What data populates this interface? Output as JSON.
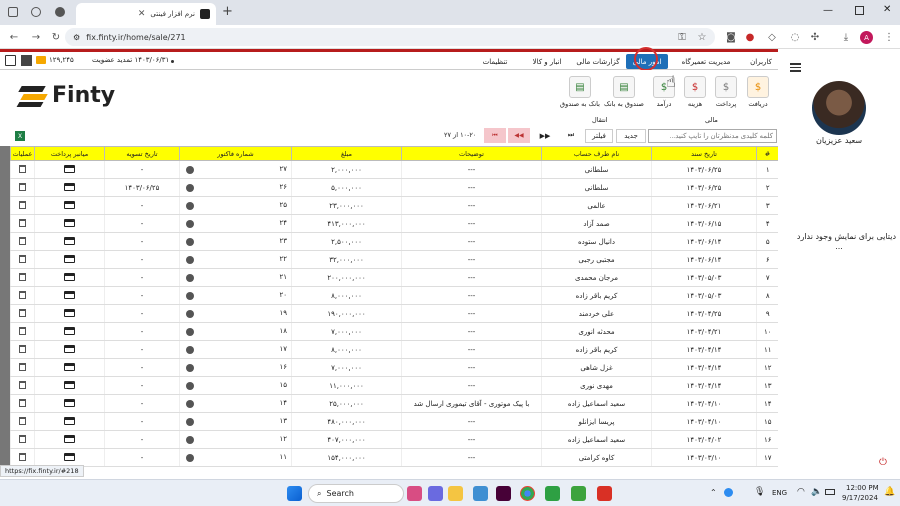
{
  "browser": {
    "tab_title": "نرم افزار فینتی",
    "url": "fix.finty.ir/home/sale/271",
    "profile_initial": "A",
    "status_url": "https://fix.finty.ir/#218"
  },
  "app": {
    "menu_tabs": [
      "کاربران",
      "مدیریت تعمیرگاه",
      "امور مالی",
      "گزارشات مالی",
      "انبار و کالا",
      "تنظیمات"
    ],
    "active_tab": "امور مالی",
    "account_text": "۱۴۰۳/۰۶/۳۱ تمدید عضویت",
    "balance": "۱۲۹,۲۴۵",
    "ribbon_buttons": [
      "دریافت",
      "پرداخت",
      "هزینه",
      "درآمد",
      "صندوق به بانک",
      "بانک به صندوق"
    ],
    "ribbon_groups": [
      "مالی",
      "انتقال"
    ],
    "logo_text": "Finty"
  },
  "grid_toolbar": {
    "search_placeholder": "کلمه کلیدی مدنظرتان را تایپ کنید...",
    "new_label": "جدید",
    "filter_label": "فیلتر",
    "paging": "۱۰-۲۰ از ۲۷"
  },
  "table": {
    "columns": [
      "#",
      "تاریخ سند",
      "نام طرف حساب",
      "توضیحات",
      "مبلغ",
      "شماره فاکتور",
      "تاریخ تسویه",
      "میانبر پرداخت",
      "عملیات"
    ],
    "rows": [
      [
        "۱",
        "۱۴۰۳/۰۶/۲۵",
        "سلطانی",
        "---",
        "۲,۰۰۰,۰۰۰",
        "۲۷",
        "-"
      ],
      [
        "۲",
        "۱۴۰۳/۰۶/۲۵",
        "سلطانی",
        "---",
        "۵,۰۰۰,۰۰۰",
        "۲۶",
        "۱۴۰۳/۰۶/۲۵"
      ],
      [
        "۳",
        "۱۴۰۳/۰۶/۲۱",
        "عالمی",
        "---",
        "۲۳,۰۰۰,۰۰۰",
        "۲۵",
        "-"
      ],
      [
        "۴",
        "۱۴۰۳/۰۶/۱۵",
        "صمد آزاد",
        "---",
        "۴۱۳,۰۰۰,۰۰۰",
        "۲۴",
        "-"
      ],
      [
        "۵",
        "۱۴۰۳/۰۶/۱۴",
        "دانیال ستوده",
        "---",
        "۲,۵۰۰,۰۰۰",
        "۲۳",
        "-"
      ],
      [
        "۶",
        "۱۴۰۳/۰۶/۱۴",
        "مجتبی رجبی",
        "---",
        "۳۲,۰۰۰,۰۰۰",
        "۲۲",
        "-"
      ],
      [
        "۷",
        "۱۴۰۳/۰۵/۰۳",
        "مرجان محمدی",
        "---",
        "۲۰۰,۰۰۰,۰۰۰",
        "۲۱",
        "-"
      ],
      [
        "۸",
        "۱۴۰۳/۰۵/۰۳",
        "کریم باقر زاده",
        "---",
        "۸,۰۰۰,۰۰۰",
        "۲۰",
        "-"
      ],
      [
        "۹",
        "۱۴۰۳/۰۴/۲۵",
        "علی خردمند",
        "---",
        "۱۹۰,۰۰۰,۰۰۰",
        "۱۹",
        "-"
      ],
      [
        "۱۰",
        "۱۴۰۳/۰۴/۲۱",
        "محدثه انوری",
        "---",
        "۷,۰۰۰,۰۰۰",
        "۱۸",
        "-"
      ],
      [
        "۱۱",
        "۱۴۰۳/۰۴/۱۴",
        "کریم باقر زاده",
        "---",
        "۸,۰۰۰,۰۰۰",
        "۱۷",
        "-"
      ],
      [
        "۱۲",
        "۱۴۰۳/۰۴/۱۴",
        "غزل شاهی",
        "---",
        "۷,۰۰۰,۰۰۰",
        "۱۶",
        "-"
      ],
      [
        "۱۳",
        "۱۴۰۳/۰۴/۱۴",
        "مهدی نوری",
        "---",
        "۱۱,۰۰۰,۰۰۰",
        "۱۵",
        "-"
      ],
      [
        "۱۴",
        "۱۴۰۳/۰۴/۱۰",
        "سعید اسماعیل زاده",
        "با پیک موتوری - آقای تیموری ارسال شد",
        "۲۵,۰۰۰,۰۰۰",
        "۱۴",
        "-"
      ],
      [
        "۱۵",
        "۱۴۰۳/۰۴/۱۰",
        "پریسا ایزانلو",
        "---",
        "۴۸۰,۰۰۰,۰۰۰",
        "۱۳",
        "-"
      ],
      [
        "۱۶",
        "۱۴۰۳/۰۴/۰۲",
        "سعید اسماعیل زاده",
        "---",
        "۴۰۷,۰۰۰,۰۰۰",
        "۱۲",
        "-"
      ],
      [
        "۱۷",
        "۱۴۰۳/۰۳/۱۰",
        "کاوه کرامتی",
        "---",
        "۱۵۴,۰۰۰,۰۰۰",
        "۱۱",
        "-"
      ]
    ]
  },
  "profile": {
    "name": "سعید عزیزیان",
    "empty_message": "دیتایی برای نمایش وجود ندارد",
    "ellipsis": "..."
  },
  "taskbar": {
    "search_label": "Search",
    "lang": "ENG",
    "time": "12:00 PM",
    "date": "9/17/2024"
  },
  "colors": {
    "header_yellow": "#ffff00",
    "active_tab": "#1e6fb8",
    "top_bar": "#b71c1c"
  }
}
